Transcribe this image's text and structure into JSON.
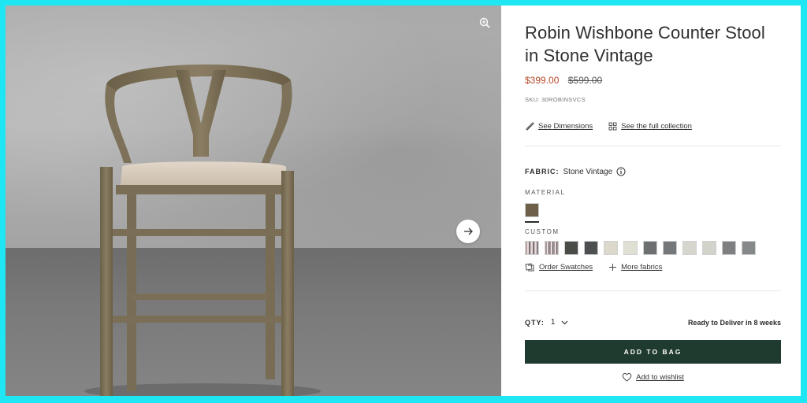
{
  "product": {
    "title": "Robin Wishbone Counter Stool in Stone Vintage",
    "sale_price": "$399.00",
    "original_price": "$599.00",
    "sku": "SKU: 30ROBINSVCS"
  },
  "links": {
    "dimensions": "See Dimensions",
    "collection": "See the full collection"
  },
  "fabric": {
    "label": "FABRIC:",
    "value": "Stone Vintage"
  },
  "material": {
    "label": "MATERIAL",
    "swatches": [
      {
        "name": "stone-vintage",
        "color": "#6e5f48",
        "selected": true
      }
    ]
  },
  "custom": {
    "label": "CUSTOM",
    "swatches": [
      {
        "color": "#b9a7a7",
        "pattern": "stripe"
      },
      {
        "color": "#a99a9a",
        "pattern": "stripe"
      },
      {
        "color": "#4a4c48"
      },
      {
        "color": "#4c5050"
      },
      {
        "color": "#dcd8cc"
      },
      {
        "color": "#e0dfd3"
      },
      {
        "color": "#6c7071"
      },
      {
        "color": "#74787a"
      },
      {
        "color": "#d6d6cf"
      },
      {
        "color": "#d2d4cb"
      },
      {
        "color": "#7d7f80"
      },
      {
        "color": "#86898a"
      }
    ]
  },
  "actions": {
    "order_swatches": "Order Swatches",
    "more_fabrics": "More fabrics"
  },
  "purchase": {
    "qty_label": "QTY:",
    "qty_value": "1",
    "delivery": "Ready to Deliver in 8 weeks",
    "add_to_bag": "ADD TO BAG",
    "wishlist": "Add to wishlist"
  },
  "colors": {
    "accent": "#1f3a2e",
    "sale": "#b6482b",
    "frame": "#1ee6f2"
  },
  "icons": [
    "zoom-in-icon",
    "arrow-right-icon",
    "ruler-icon",
    "grid-icon",
    "info-icon",
    "swatch-icon",
    "plus-icon",
    "chevron-down-icon",
    "heart-icon"
  ]
}
